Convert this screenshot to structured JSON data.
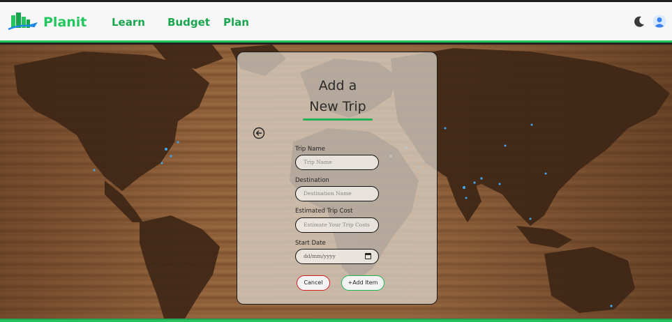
{
  "header": {
    "brand": "Planit",
    "nav": {
      "learn": "Learn",
      "budget": "Budget",
      "plan": "Plan"
    },
    "icons": {
      "logo": "city-plane-logo-icon",
      "theme": "moon-icon",
      "account": "user-icon"
    }
  },
  "form": {
    "title_line1": "Add a",
    "title_line2": "New Trip",
    "back_icon": "arrow-left-circle-icon",
    "trip_name": {
      "label": "Trip Name",
      "placeholder": "Trip Name"
    },
    "destination": {
      "label": "Destination",
      "placeholder": "Destination Name"
    },
    "cost": {
      "label": "Estimated Trip Cost",
      "placeholder": "Estimate Your Trip Costs"
    },
    "start_date": {
      "label": "Start Date",
      "placeholder": "dd/mm/yyyy",
      "icon": "calendar-icon"
    },
    "cancel_label": "Cancel",
    "add_label": "+Add Item"
  },
  "colors": {
    "accent": "#22c55e",
    "nav_text": "#1aa64f",
    "cancel_border": "#d32020",
    "add_border": "#22b357"
  }
}
